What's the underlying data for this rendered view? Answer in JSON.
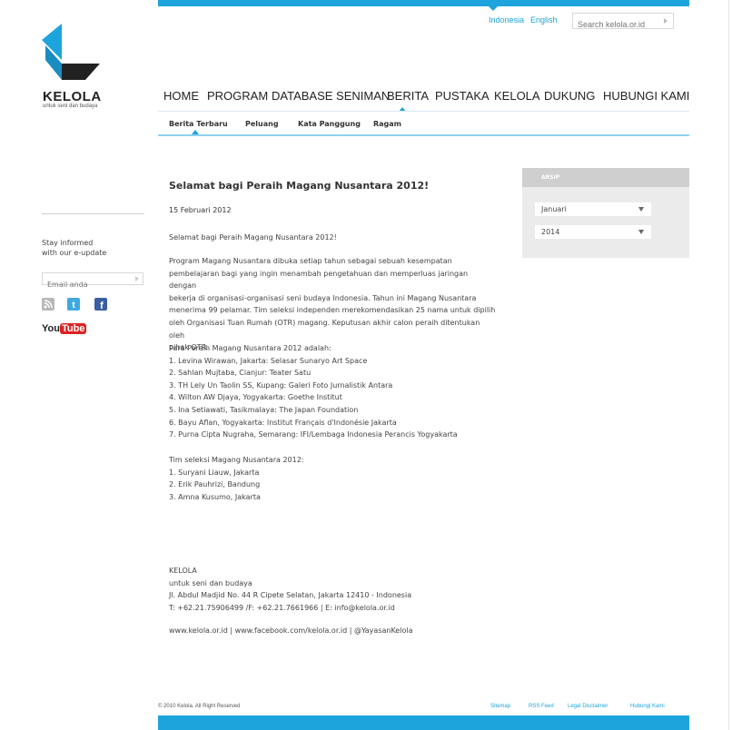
{
  "brand": {
    "name": "KELOLA",
    "tagline": "untuk seni dan budaya",
    "accent": "#1ea4dc"
  },
  "header": {
    "languages": [
      "Indonesia",
      "English"
    ],
    "search_placeholder": "Search kelola.or.id"
  },
  "main_nav": {
    "items": [
      "HOME",
      "PROGRAM",
      "DATABASE SENIMAN",
      "BERITA",
      "PUSTAKA",
      "KELOLA",
      "DUKUNG",
      "HUBUNGI KAMI"
    ],
    "active": "BERITA"
  },
  "sub_nav": {
    "items": [
      "Berita Terbaru",
      "Peluang",
      "Kata Panggung",
      "Ragam"
    ],
    "active": "Berita Terbaru"
  },
  "sidebar": {
    "stay_line1": "Stay informed",
    "stay_line2": "with our e-update",
    "email_placeholder": "Email anda",
    "social": [
      "rss-icon",
      "twitter-icon",
      "facebook-icon",
      "youtube-icon"
    ],
    "youtube_text_1": "You",
    "youtube_text_2": "Tube"
  },
  "article": {
    "title": "Selamat bagi Peraih Magang Nusantara 2012!",
    "date": "15 Februari 2012",
    "lead": "Selamat bagi Peraih Magang Nusantara 2012!",
    "body_lines": [
      "Program Magang Nusantara dibuka setiap tahun sebagai sebuah kesempatan",
      "pembelajaran bagi yang ingin menambah pengetahuan dan memperluas jaringan dengan",
      "bekerja di organisasi-organisasi seni budaya Indonesia. Tahun ini Magang Nusantara",
      "menerima 99 pelamar. Tim seleksi independen merekomendasikan 25 nama untuk dipilih",
      "oleh Organisasi Tuan Rumah (OTR) magang. Keputusan akhir calon peraih ditentukan oleh",
      "pihak OTR."
    ],
    "winners_heading": "Para Peraih Magang Nusantara 2012 adalah:",
    "winners": [
      "1. Levina Wirawan, Jakarta: Selasar Sunaryo Art Space",
      "2. Sahlan Mujtaba, Cianjur: Teater Satu",
      "3. TH Lely Un Taolin SS, Kupang: Galeri Foto Jurnalistik Antara",
      "4. Wilton AW Djaya, Yogyakarta: Goethe Institut",
      "5. Ina Setiawati, Tasikmalaya: The Japan Foundation",
      "6. Bayu Aflan, Yogyakarta: Institut Français d'Indonésie Jakarta",
      "7. Purna Cipta Nugraha, Semarang: IFI/Lembaga Indonesia Perancis Yogyakarta"
    ],
    "team_heading": "Tim seleksi Magang Nusantara 2012:",
    "team": [
      "1. Suryani Liauw, Jakarta",
      "2. Erik Pauhrizi, Bandung",
      "3. Amna Kusumo, Jakarta"
    ]
  },
  "contact": {
    "lines": [
      "KELOLA",
      "untuk seni dan budaya",
      "Jl. Abdul Madjid No. 44 R Cipete Selatan, Jakarta 12410 - Indonesia",
      "T: +62.21.75906499 /F: +62.21.7661966 | E: info@kelola.or.id"
    ],
    "web": "www.kelola.or.id | www.facebook.com/kelola.or.id | @YayasanKelola"
  },
  "archive": {
    "heading": "ARSIP",
    "month": "Januari",
    "year": "2014"
  },
  "footer": {
    "copyright": "© 2010 Kelola. All Right Reserved",
    "links": [
      "Sitemap",
      "RSS Feed",
      "Legal Disclaimer",
      "Hubungi Kami"
    ]
  }
}
